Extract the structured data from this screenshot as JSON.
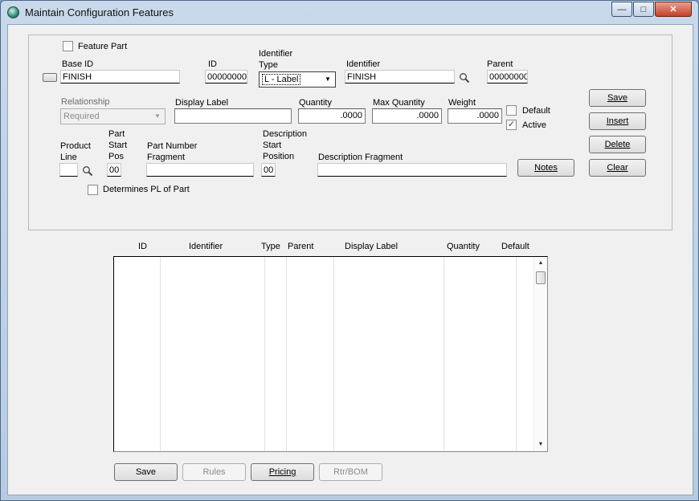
{
  "window": {
    "title": "Maintain Configuration Features",
    "minimize": "—",
    "maximize": "□",
    "close": "✕"
  },
  "form": {
    "feature_part_label": "Feature Part",
    "base_id_label": "Base ID",
    "base_id_value": "FINISH",
    "id_label": "ID",
    "id_value": "00000000",
    "identifier_type_label_1": "Identifier",
    "identifier_type_label_2": "Type",
    "identifier_type_value": "L - Label",
    "identifier_label": "Identifier",
    "identifier_value": "FINISH",
    "parent_label": "Parent",
    "parent_value": "00000000",
    "relationship_label": "Relationship",
    "relationship_value": "Required",
    "display_label_label": "Display Label",
    "display_label_value": "",
    "quantity_label": "Quantity",
    "quantity_value": ".0000",
    "max_quantity_label": "Max Quantity",
    "max_quantity_value": ".0000",
    "weight_label": "Weight",
    "weight_value": ".0000",
    "default_label": "Default",
    "active_label": "Active",
    "product_line_label_1": "Product",
    "product_line_label_2": "Line",
    "part_start_pos_label_1": "Part",
    "part_start_pos_label_2": "Start",
    "part_start_pos_label_3": "Pos",
    "part_start_pos_value": "00",
    "part_number_fragment_label_1": "Part Number",
    "part_number_fragment_label_2": "Fragment",
    "desc_start_label_1": "Description",
    "desc_start_label_2": "Start",
    "desc_start_label_3": "Position",
    "desc_start_value": "00",
    "description_fragment_label": "Description Fragment",
    "determines_pl_label": "Determines PL of Part",
    "active_checked": "✓"
  },
  "buttons": {
    "save": "Save",
    "insert": "Insert",
    "delete": "Delete",
    "clear": "Clear",
    "notes": "Notes",
    "bottom_save": "Save",
    "rules": "Rules",
    "pricing": "Pricing",
    "rtr_bom": "Rtr/BOM"
  },
  "grid": {
    "columns": [
      "ID",
      "Identifier",
      "Type",
      "Parent",
      "Display Label",
      "Quantity",
      "Default"
    ],
    "rows": []
  }
}
